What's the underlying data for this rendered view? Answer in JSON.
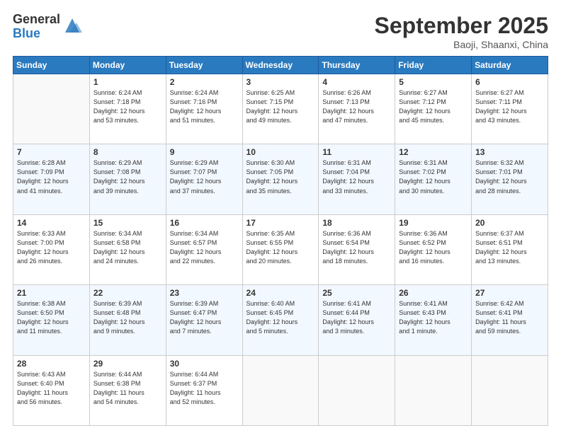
{
  "logo": {
    "general": "General",
    "blue": "Blue"
  },
  "header": {
    "title": "September 2025",
    "subtitle": "Baoji, Shaanxi, China"
  },
  "weekdays": [
    "Sunday",
    "Monday",
    "Tuesday",
    "Wednesday",
    "Thursday",
    "Friday",
    "Saturday"
  ],
  "weeks": [
    [
      {
        "day": "",
        "info": ""
      },
      {
        "day": "1",
        "info": "Sunrise: 6:24 AM\nSunset: 7:18 PM\nDaylight: 12 hours\nand 53 minutes."
      },
      {
        "day": "2",
        "info": "Sunrise: 6:24 AM\nSunset: 7:16 PM\nDaylight: 12 hours\nand 51 minutes."
      },
      {
        "day": "3",
        "info": "Sunrise: 6:25 AM\nSunset: 7:15 PM\nDaylight: 12 hours\nand 49 minutes."
      },
      {
        "day": "4",
        "info": "Sunrise: 6:26 AM\nSunset: 7:13 PM\nDaylight: 12 hours\nand 47 minutes."
      },
      {
        "day": "5",
        "info": "Sunrise: 6:27 AM\nSunset: 7:12 PM\nDaylight: 12 hours\nand 45 minutes."
      },
      {
        "day": "6",
        "info": "Sunrise: 6:27 AM\nSunset: 7:11 PM\nDaylight: 12 hours\nand 43 minutes."
      }
    ],
    [
      {
        "day": "7",
        "info": "Sunrise: 6:28 AM\nSunset: 7:09 PM\nDaylight: 12 hours\nand 41 minutes."
      },
      {
        "day": "8",
        "info": "Sunrise: 6:29 AM\nSunset: 7:08 PM\nDaylight: 12 hours\nand 39 minutes."
      },
      {
        "day": "9",
        "info": "Sunrise: 6:29 AM\nSunset: 7:07 PM\nDaylight: 12 hours\nand 37 minutes."
      },
      {
        "day": "10",
        "info": "Sunrise: 6:30 AM\nSunset: 7:05 PM\nDaylight: 12 hours\nand 35 minutes."
      },
      {
        "day": "11",
        "info": "Sunrise: 6:31 AM\nSunset: 7:04 PM\nDaylight: 12 hours\nand 33 minutes."
      },
      {
        "day": "12",
        "info": "Sunrise: 6:31 AM\nSunset: 7:02 PM\nDaylight: 12 hours\nand 30 minutes."
      },
      {
        "day": "13",
        "info": "Sunrise: 6:32 AM\nSunset: 7:01 PM\nDaylight: 12 hours\nand 28 minutes."
      }
    ],
    [
      {
        "day": "14",
        "info": "Sunrise: 6:33 AM\nSunset: 7:00 PM\nDaylight: 12 hours\nand 26 minutes."
      },
      {
        "day": "15",
        "info": "Sunrise: 6:34 AM\nSunset: 6:58 PM\nDaylight: 12 hours\nand 24 minutes."
      },
      {
        "day": "16",
        "info": "Sunrise: 6:34 AM\nSunset: 6:57 PM\nDaylight: 12 hours\nand 22 minutes."
      },
      {
        "day": "17",
        "info": "Sunrise: 6:35 AM\nSunset: 6:55 PM\nDaylight: 12 hours\nand 20 minutes."
      },
      {
        "day": "18",
        "info": "Sunrise: 6:36 AM\nSunset: 6:54 PM\nDaylight: 12 hours\nand 18 minutes."
      },
      {
        "day": "19",
        "info": "Sunrise: 6:36 AM\nSunset: 6:52 PM\nDaylight: 12 hours\nand 16 minutes."
      },
      {
        "day": "20",
        "info": "Sunrise: 6:37 AM\nSunset: 6:51 PM\nDaylight: 12 hours\nand 13 minutes."
      }
    ],
    [
      {
        "day": "21",
        "info": "Sunrise: 6:38 AM\nSunset: 6:50 PM\nDaylight: 12 hours\nand 11 minutes."
      },
      {
        "day": "22",
        "info": "Sunrise: 6:39 AM\nSunset: 6:48 PM\nDaylight: 12 hours\nand 9 minutes."
      },
      {
        "day": "23",
        "info": "Sunrise: 6:39 AM\nSunset: 6:47 PM\nDaylight: 12 hours\nand 7 minutes."
      },
      {
        "day": "24",
        "info": "Sunrise: 6:40 AM\nSunset: 6:45 PM\nDaylight: 12 hours\nand 5 minutes."
      },
      {
        "day": "25",
        "info": "Sunrise: 6:41 AM\nSunset: 6:44 PM\nDaylight: 12 hours\nand 3 minutes."
      },
      {
        "day": "26",
        "info": "Sunrise: 6:41 AM\nSunset: 6:43 PM\nDaylight: 12 hours\nand 1 minute."
      },
      {
        "day": "27",
        "info": "Sunrise: 6:42 AM\nSunset: 6:41 PM\nDaylight: 11 hours\nand 59 minutes."
      }
    ],
    [
      {
        "day": "28",
        "info": "Sunrise: 6:43 AM\nSunset: 6:40 PM\nDaylight: 11 hours\nand 56 minutes."
      },
      {
        "day": "29",
        "info": "Sunrise: 6:44 AM\nSunset: 6:38 PM\nDaylight: 11 hours\nand 54 minutes."
      },
      {
        "day": "30",
        "info": "Sunrise: 6:44 AM\nSunset: 6:37 PM\nDaylight: 11 hours\nand 52 minutes."
      },
      {
        "day": "",
        "info": ""
      },
      {
        "day": "",
        "info": ""
      },
      {
        "day": "",
        "info": ""
      },
      {
        "day": "",
        "info": ""
      }
    ]
  ]
}
